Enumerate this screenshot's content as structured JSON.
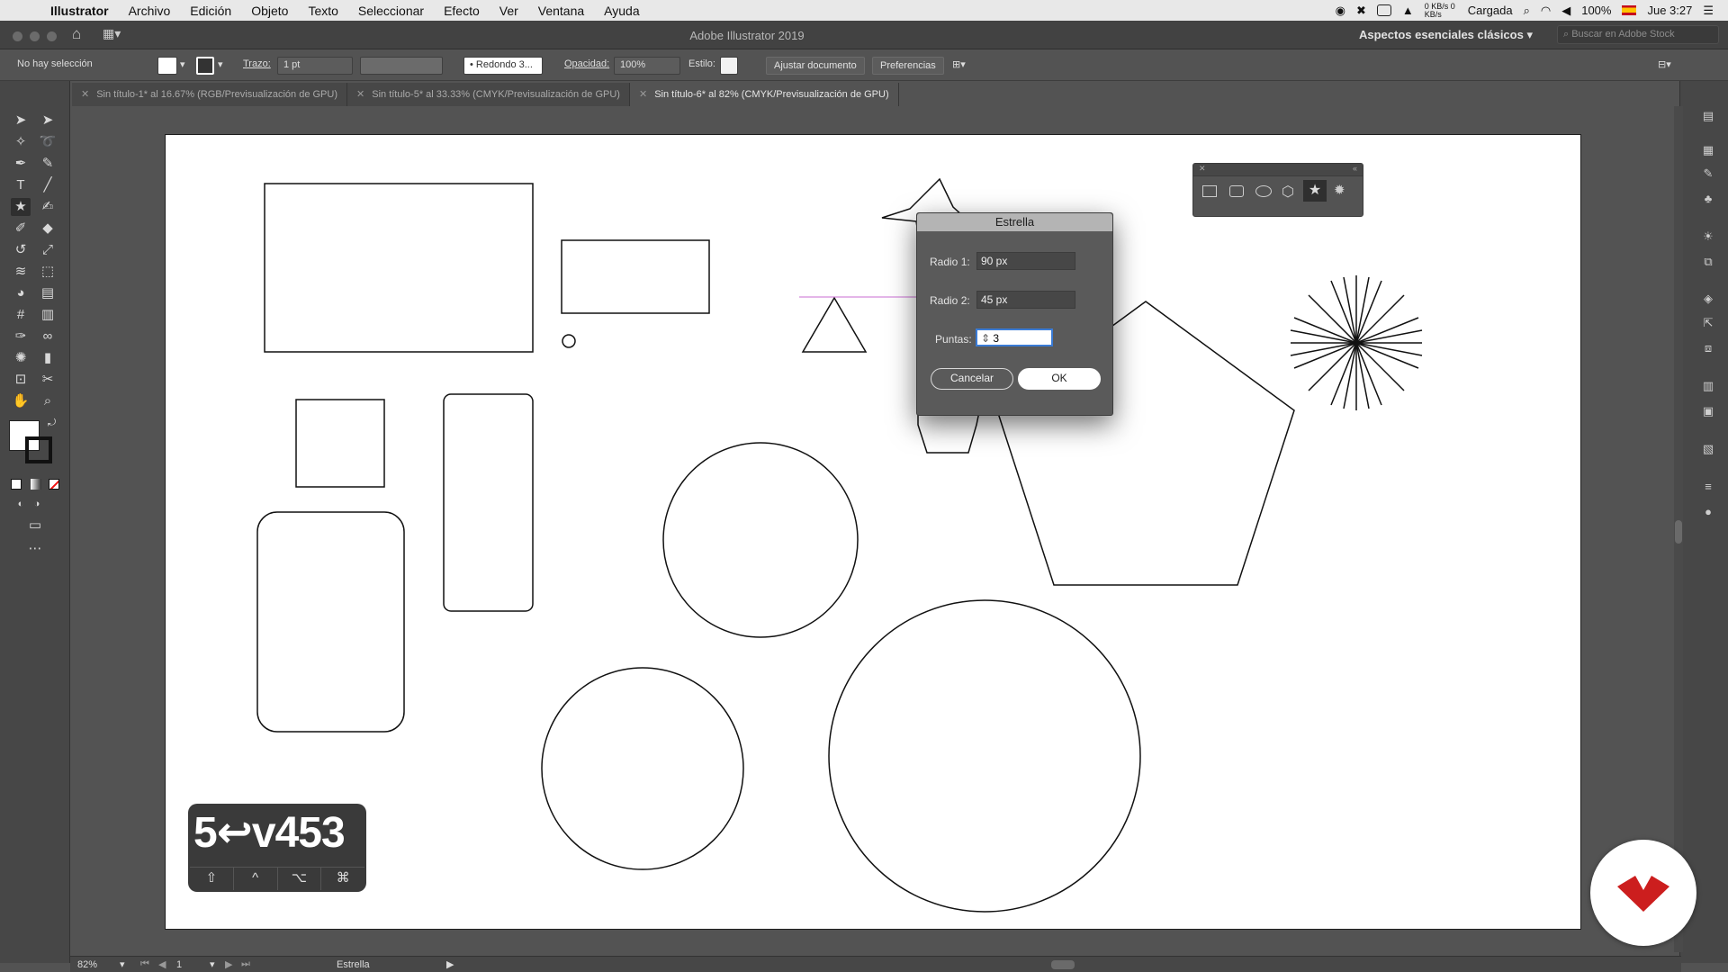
{
  "menubar": {
    "app": "Illustrator",
    "items": [
      "Archivo",
      "Edición",
      "Objeto",
      "Texto",
      "Seleccionar",
      "Efecto",
      "Ver",
      "Ventana",
      "Ayuda"
    ],
    "net": "0 KB/s 0 KB/s",
    "battery_label": "Cargada",
    "battery_pct": "100%",
    "clock": "Jue 3:27"
  },
  "window": {
    "title": "Adobe Illustrator 2019",
    "workspace": "Aspectos esenciales clásicos",
    "stock_placeholder": "Buscar en Adobe Stock"
  },
  "control": {
    "selection": "No hay selección",
    "stroke_label": "Trazo:",
    "stroke_value": "1 pt",
    "brush": "Redondo 3...",
    "opacity_label": "Opacidad:",
    "opacity_value": "100%",
    "style_label": "Estilo:",
    "fit_button": "Ajustar documento",
    "prefs_button": "Preferencias"
  },
  "tabs": [
    {
      "label": "Sin título-1* al 16.67% (RGB/Previsualización de GPU)"
    },
    {
      "label": "Sin título-5* al 33.33% (CMYK/Previsualización de GPU)"
    },
    {
      "label": "Sin título-6* al 82% (CMYK/Previsualización de GPU)"
    }
  ],
  "dialog": {
    "title": "Estrella",
    "r1_label": "Radio 1:",
    "r1_value": "90 px",
    "r2_label": "Radio 2:",
    "r2_value": "45 px",
    "points_label": "Puntas:",
    "points_value": "3",
    "cancel": "Cancelar",
    "ok": "OK"
  },
  "keystrokes": {
    "text": "5↩v453",
    "modifiers": [
      "⇧",
      "^",
      "⌥",
      "⌘"
    ]
  },
  "status": {
    "zoom": "82%",
    "page": "1",
    "tool": "Estrella"
  },
  "colors": {
    "ui_dark": "#535353",
    "panel": "#474747",
    "logo_red": "#cc1e1e",
    "guide_magenta": "#c86ed2"
  }
}
